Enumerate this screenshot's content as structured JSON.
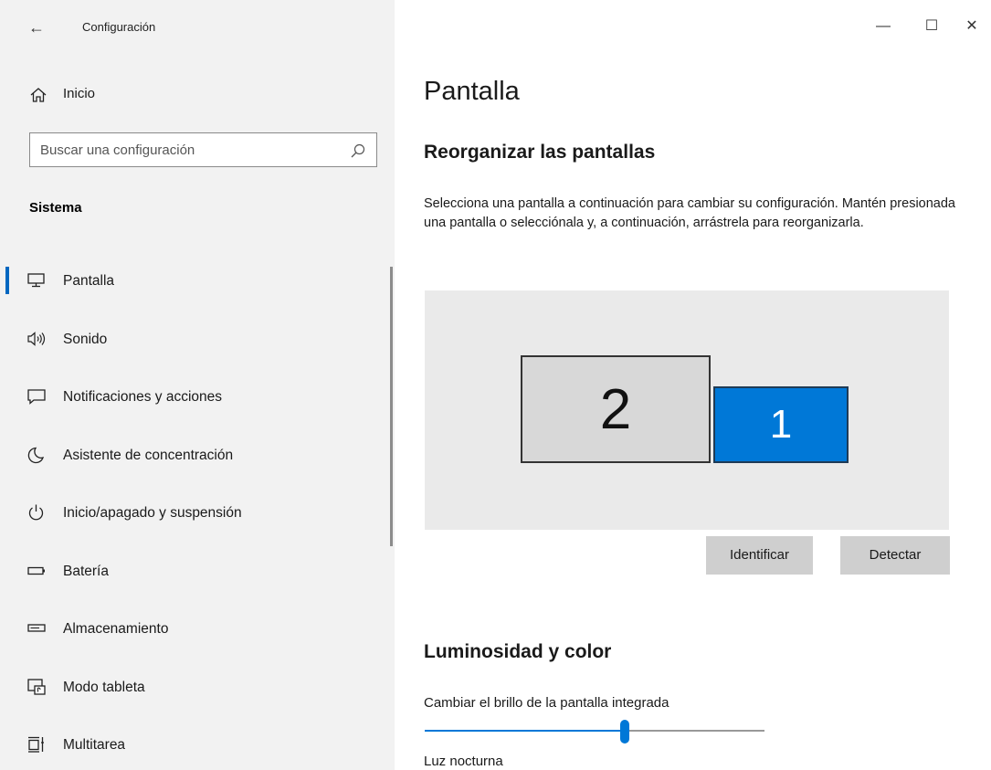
{
  "window": {
    "title": "Configuración",
    "back_icon": "back-arrow-icon",
    "minimize_glyph": "—",
    "maximize_glyph": "☐",
    "close_glyph": "✕"
  },
  "sidebar": {
    "home_label": "Inicio",
    "search_placeholder": "Buscar una configuración",
    "section_title": "Sistema",
    "active_index": 0,
    "items": [
      {
        "label": "Pantalla",
        "icon": "monitor-icon"
      },
      {
        "label": "Sonido",
        "icon": "speaker-icon"
      },
      {
        "label": "Notificaciones y acciones",
        "icon": "notification-icon"
      },
      {
        "label": "Asistente de concentración",
        "icon": "moon-icon"
      },
      {
        "label": "Inicio/apagado y suspensión",
        "icon": "power-icon"
      },
      {
        "label": "Batería",
        "icon": "battery-icon"
      },
      {
        "label": "Almacenamiento",
        "icon": "storage-icon"
      },
      {
        "label": "Modo tableta",
        "icon": "tablet-mode-icon"
      },
      {
        "label": "Multitarea",
        "icon": "multitasking-icon"
      }
    ]
  },
  "main": {
    "page_title": "Pantalla",
    "arrange_heading": "Reorganizar las pantallas",
    "arrange_desc": "Selecciona una pantalla a continuación para cambiar su configuración. Mantén presionada una pantalla o selecciónala y, a continuación, arrástrela para reorganizarla.",
    "monitors": [
      {
        "number": "2",
        "selected": false
      },
      {
        "number": "1",
        "selected": true
      }
    ],
    "identify_label": "Identificar",
    "detect_label": "Detectar",
    "brightness_heading": "Luminosidad y color",
    "brightness_label": "Cambiar el brillo de la pantalla integrada",
    "brightness_value": 0.59,
    "night_light_label": "Luz nocturna"
  },
  "colors": {
    "accent": "#0078d7",
    "sidebar_bg": "#f2f2f2",
    "button_bg": "#cfcfcf",
    "arrange_bg": "#eaeaea"
  }
}
